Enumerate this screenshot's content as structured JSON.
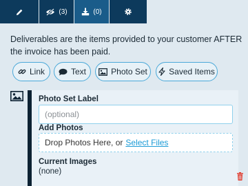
{
  "tabs": [
    {
      "icon": "pencil-icon",
      "count": ""
    },
    {
      "icon": "eye-slash-icon",
      "count": "(3)"
    },
    {
      "icon": "download-icon",
      "count": "(0)"
    },
    {
      "icon": "gear-icon",
      "count": ""
    }
  ],
  "description": "Deliverables are the items provided to your customer AFTER the invoice has been paid.",
  "chips": {
    "link": "Link",
    "text": "Text",
    "photo_set": "Photo Set",
    "saved_items": "Saved Items"
  },
  "photo_set": {
    "label_heading": "Photo Set Label",
    "label_placeholder": "(optional)",
    "add_photos_heading": "Add Photos",
    "drop_text": "Drop Photos Here, or",
    "select_files": "Select Files",
    "current_images_heading": "Current Images",
    "current_images_value": "(none)"
  },
  "colors": {
    "tab_bg": "#0d3a5c",
    "tab_active": "#1a5c8a",
    "accent": "#4aa8d8",
    "link": "#1a9ad6",
    "delete": "#e0392b"
  }
}
